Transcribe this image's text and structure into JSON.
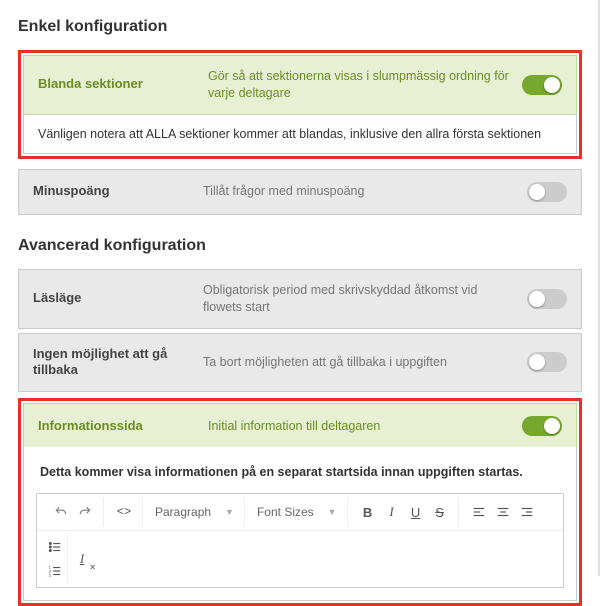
{
  "simple": {
    "title": "Enkel konfiguration",
    "shuffle": {
      "label": "Blanda sektioner",
      "desc": "Gör så att sektionerna visas i slumpmässig ordning för varje deltagare",
      "note": "Vänligen notera att ALLA sektioner kommer att blandas, inklusive den allra första sektionen"
    },
    "negative": {
      "label": "Minuspoäng",
      "desc": "Tillåt frågor med minuspoäng"
    }
  },
  "advanced": {
    "title": "Avancerad konfiguration",
    "readmode": {
      "label": "Läsläge",
      "desc": "Obligatorisk period med skrivskyddad åtkomst vid flowets start"
    },
    "noback": {
      "label": "Ingen möjlighet att gå tillbaka",
      "desc": "Ta bort möjligheten att gå tillbaka i uppgiften"
    },
    "infopage": {
      "label": "Informationssida",
      "desc": "Initial information till deltagaren",
      "note": "Detta kommer visa informationen på en separat startsida innan uppgiften startas."
    }
  },
  "editor": {
    "paragraph": "Paragraph",
    "fontsizes": "Font Sizes"
  }
}
